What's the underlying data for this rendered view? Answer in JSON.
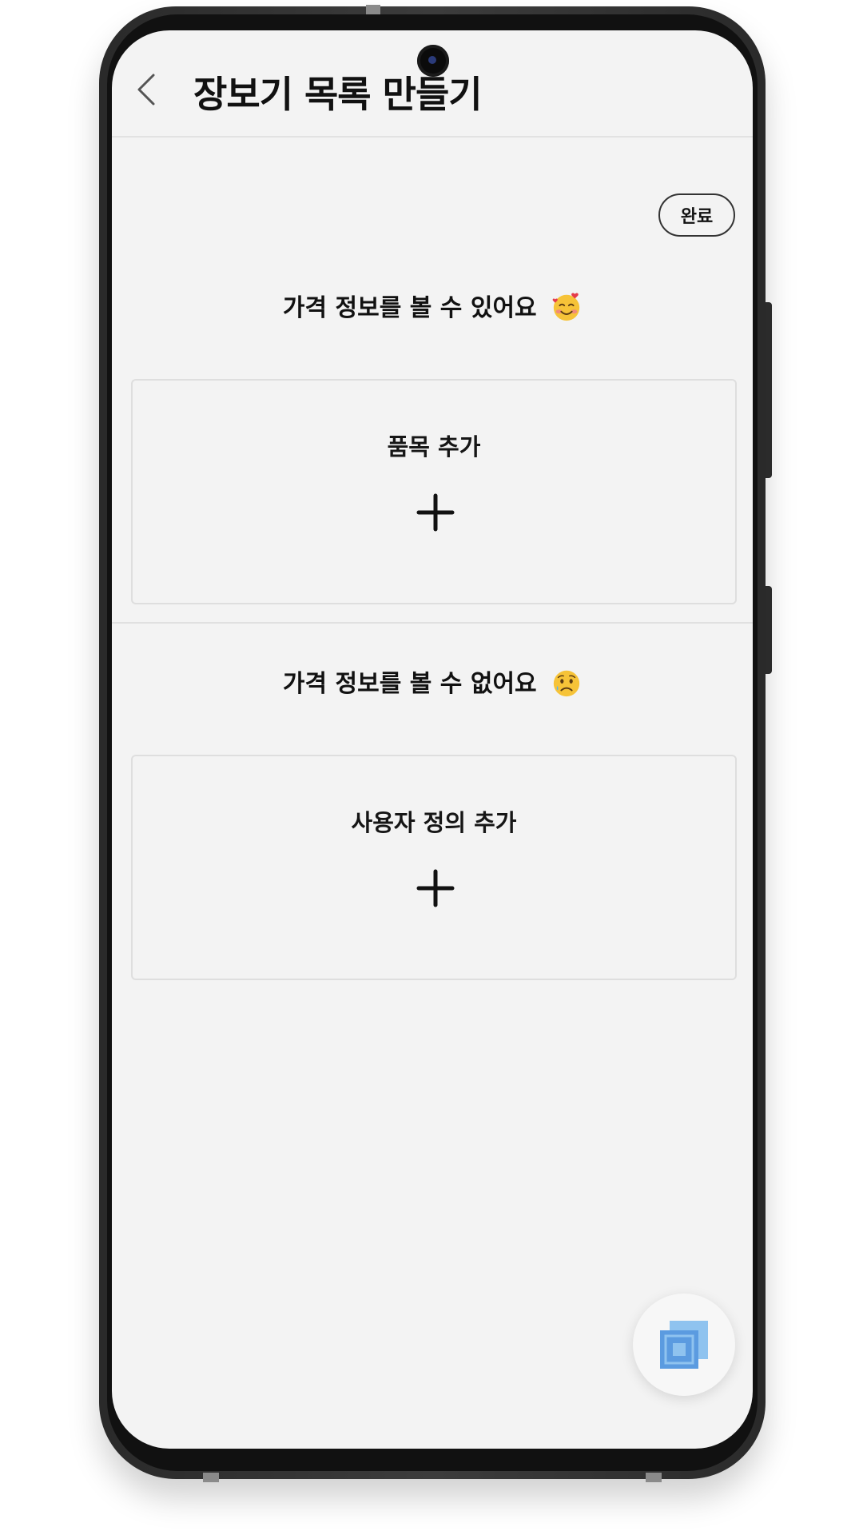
{
  "header": {
    "title": "장보기 목록 만들기",
    "back_icon": "chevron-left-icon"
  },
  "toolbar": {
    "done_label": "완료"
  },
  "sections": [
    {
      "heading": "가격 정보를 볼 수 있어요",
      "emoji": "smiling-face-with-hearts-icon",
      "card_label": "품목 추가",
      "card_icon": "plus-icon"
    },
    {
      "heading": "가격 정보를 볼 수 없어요",
      "emoji": "sad-face-icon",
      "card_label": "사용자 정의 추가",
      "card_icon": "plus-icon"
    }
  ],
  "fab": {
    "icon": "overlapping-squares-icon"
  },
  "colors": {
    "screen_background": "#f3f3f3",
    "text": "#111111",
    "card_border": "#dedede",
    "fab_icon_light": "#8fc3ef",
    "fab_icon_dark": "#5b9be0"
  }
}
